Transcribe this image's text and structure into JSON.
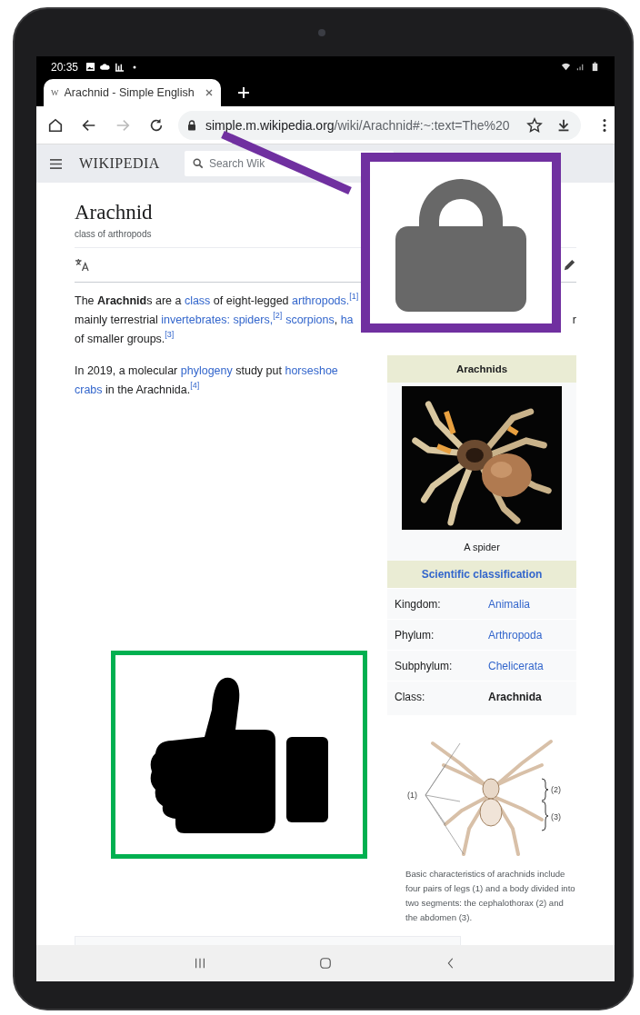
{
  "status_bar": {
    "time": "20:35"
  },
  "tabs": [
    {
      "favicon": "W",
      "title": "Arachnid - Simple English",
      "selected": true
    }
  ],
  "toolbar": [
    {
      "kind": "home",
      "disabled": false
    },
    {
      "kind": "back",
      "disabled": false
    },
    {
      "kind": "forward",
      "disabled": true
    },
    {
      "kind": "reload",
      "disabled": false
    }
  ],
  "address_bar": {
    "host": "simple.m.wikipedia.org",
    "path": "/wiki/Arachnid#:~:text=The%20"
  },
  "wiki_header": {
    "logo": "WIKIPEDIA",
    "search": {
      "placeholder": "Search Wik"
    }
  },
  "article": {
    "title": "Arachnid",
    "subtitle": "class of arthropods",
    "intro_lines": [
      [
        {
          "kind": "text",
          "text": "The **Arachnid**s are a "
        },
        {
          "kind": "link",
          "text": "class"
        },
        {
          "kind": "text",
          "text": " of eight-legged "
        },
        {
          "kind": "link",
          "text": "arthropods."
        },
        {
          "kind": "ref",
          "text": "[1]"
        }
      ],
      [
        {
          "kind": "text",
          "text": "mainly terrestrial "
        },
        {
          "kind": "link",
          "text": "invertebrates: spiders,"
        },
        {
          "kind": "ref",
          "text": "[2]"
        },
        {
          "kind": "spaced_link",
          "text": "scorpions"
        },
        {
          "kind": "text",
          "text": ", "
        },
        {
          "kind": "link",
          "text": "ha"
        },
        {
          "kind": "tail",
          "text": "r"
        }
      ],
      [
        {
          "kind": "text",
          "text": "of smaller groups."
        },
        {
          "kind": "ref",
          "text": "[3]"
        }
      ]
    ],
    "lines": [
      [
        {
          "kind": "text",
          "text": "In 2019, a molecular "
        },
        {
          "kind": "link",
          "text": "phylogeny"
        },
        {
          "kind": "text",
          "text": " study put "
        },
        {
          "kind": "link",
          "text": "horseshoe"
        }
      ],
      [
        {
          "kind": "link",
          "text": "crabs"
        },
        {
          "kind": "text",
          "text": " in the Arachnida."
        },
        {
          "kind": "ref",
          "text": "[4]"
        }
      ]
    ]
  },
  "infobox": {
    "title": "Arachnids",
    "caption": "A spider",
    "section": "Scientific classification",
    "rows": [
      {
        "label": "Kingdom:",
        "value": "Animalia",
        "link": true
      },
      {
        "label": "Phylum:",
        "value": "Arthropoda",
        "link": true
      },
      {
        "label": "Subphylum:",
        "value": "Chelicerata",
        "link": true
      },
      {
        "label": "Class:",
        "value": "Arachnida",
        "link": false
      }
    ]
  },
  "figure": {
    "labels": [
      "(1)",
      "(2)",
      "(3)"
    ],
    "caption": "Basic characteristics of arachnids include four pairs of legs (1) and a body divided into two segments: the cephalothorax (2) and the abdomen (3)."
  }
}
